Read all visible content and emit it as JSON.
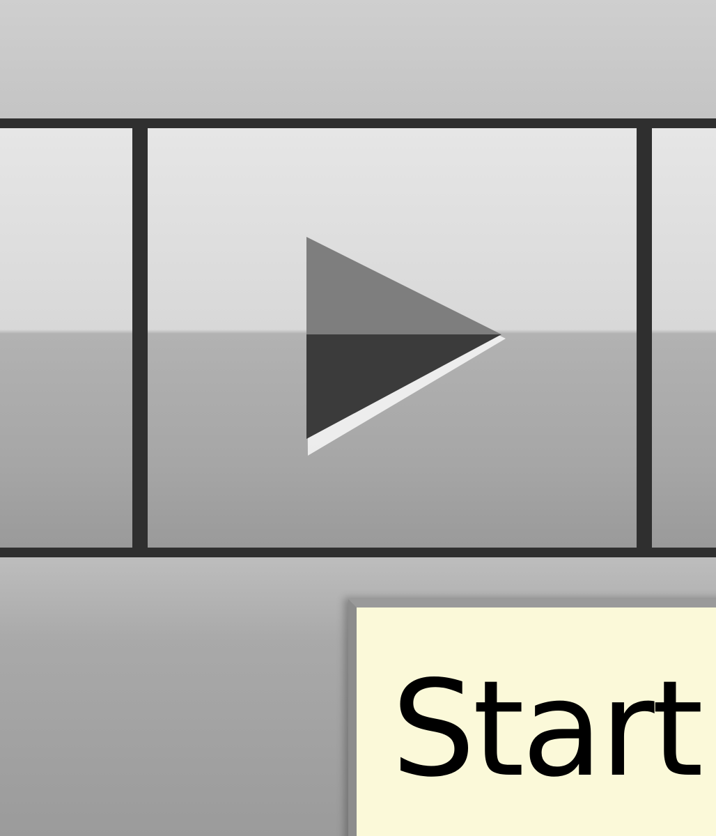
{
  "toolbar": {
    "segments": [
      {
        "id": "left",
        "icon": null
      },
      {
        "id": "start",
        "icon": "play-icon"
      },
      {
        "id": "right",
        "icon": null
      }
    ]
  },
  "tooltip": {
    "text": "Start"
  },
  "colors": {
    "segment_top": "#e6e6e6",
    "segment_bottom": "#9a9a9a",
    "divider": "#2f2f2f",
    "tooltip_bg": "#fbf9d9",
    "icon_dark": "#3b3b3b",
    "icon_light": "#7e7e7e"
  }
}
